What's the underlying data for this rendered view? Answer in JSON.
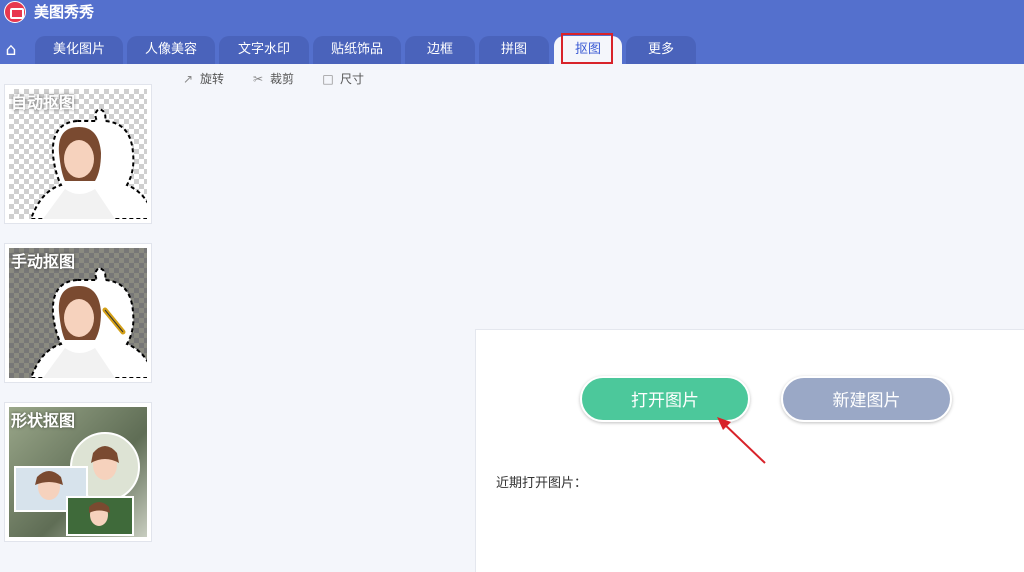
{
  "app": {
    "title": "美图秀秀"
  },
  "tabs": [
    "美化图片",
    "人像美容",
    "文字水印",
    "贴纸饰品",
    "边框",
    "拼图",
    "抠图",
    "更多"
  ],
  "active_tab": "抠图",
  "toolbar": {
    "rotate": "旋转",
    "crop": "裁剪",
    "size": "尺寸"
  },
  "sidebar": {
    "items": [
      {
        "label": "自动抠图"
      },
      {
        "label": "手动抠图"
      },
      {
        "label": "形状抠图"
      }
    ]
  },
  "panel": {
    "open_button": "打开图片",
    "new_button": "新建图片",
    "recent_label": "近期打开图片："
  },
  "colors": {
    "topbar": "#5470cd",
    "tab": "#4a63bb",
    "open_button": "#4cc89b",
    "new_button": "#9aa8c6",
    "highlight": "#d8232a"
  }
}
